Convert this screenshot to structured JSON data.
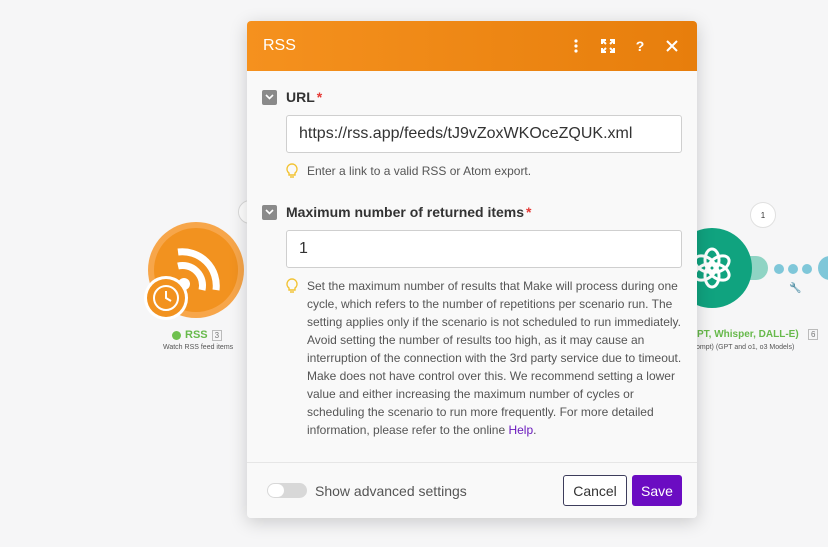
{
  "modal": {
    "title": "RSS",
    "header_icons": [
      "more-vertical-icon",
      "expand-icon",
      "help-icon",
      "close-icon"
    ],
    "fields": [
      {
        "label": "URL",
        "required": "*",
        "value": "https://rss.app/feeds/tJ9vZoxWKOceZQUK.xml",
        "hint": "Enter a link to a valid RSS or Atom export."
      },
      {
        "label": "Maximum number of returned items",
        "required": "*",
        "value": "1",
        "hint": "Set the maximum number of results that Make will process during one cycle, which refers to the number of repetitions per scenario run. The setting applies only if the scenario is not scheduled to run immediately. Avoid setting the number of results too high, as it may cause an interruption of the connection with the 3rd party service due to timeout. Make does not have control over this. We recommend setting a lower value and either increasing the maximum number of cycles or scheduling the scenario to run more frequently. For more detailed information, please refer to the online",
        "hint_link": "Help",
        "hint_end": "."
      }
    ],
    "footer": {
      "advanced_label": "Show advanced settings",
      "cancel_label": "Cancel",
      "save_label": "Save"
    }
  },
  "background": {
    "rss_node": {
      "title": "RSS",
      "count": "3",
      "subtitle": "Watch RSS feed items"
    },
    "gpt_node": {
      "title": "PT, Whisper, DALL-E)",
      "count": "6",
      "subtitle": "ompt) (GPT and o1, o3 Models)",
      "bubble_count": "1"
    }
  },
  "colors": {
    "header_start": "#f5911e",
    "header_end": "#e77e0c",
    "save": "#6b0cc2",
    "link": "#6b1bbd",
    "required": "#e53935"
  }
}
